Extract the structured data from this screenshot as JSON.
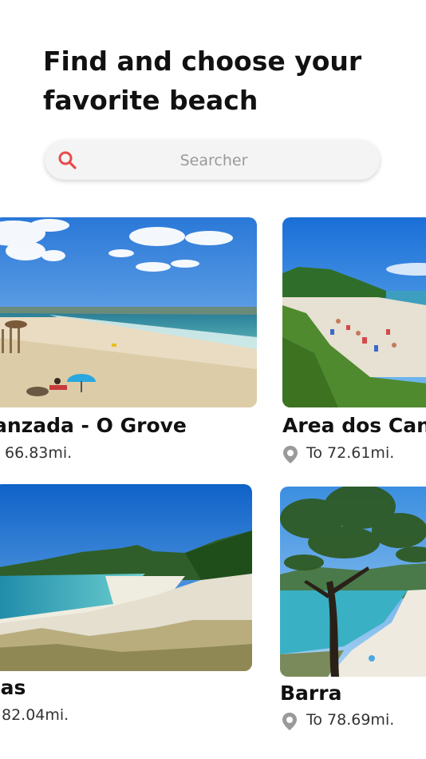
{
  "header": {
    "title": "Find and choose your favorite beach"
  },
  "search": {
    "placeholder": "Searcher",
    "icon": "search-icon"
  },
  "beaches": [
    {
      "name": "anzada - O Grove",
      "distance": "66.83mi."
    },
    {
      "name": "Area dos Cans",
      "distance": "To 72.61mi."
    },
    {
      "name": "las",
      "distance": "82.04mi."
    },
    {
      "name": "Barra",
      "distance": "To 78.69mi."
    }
  ],
  "colors": {
    "accent": "#e84a4a",
    "pin": "#9a9a9a"
  }
}
